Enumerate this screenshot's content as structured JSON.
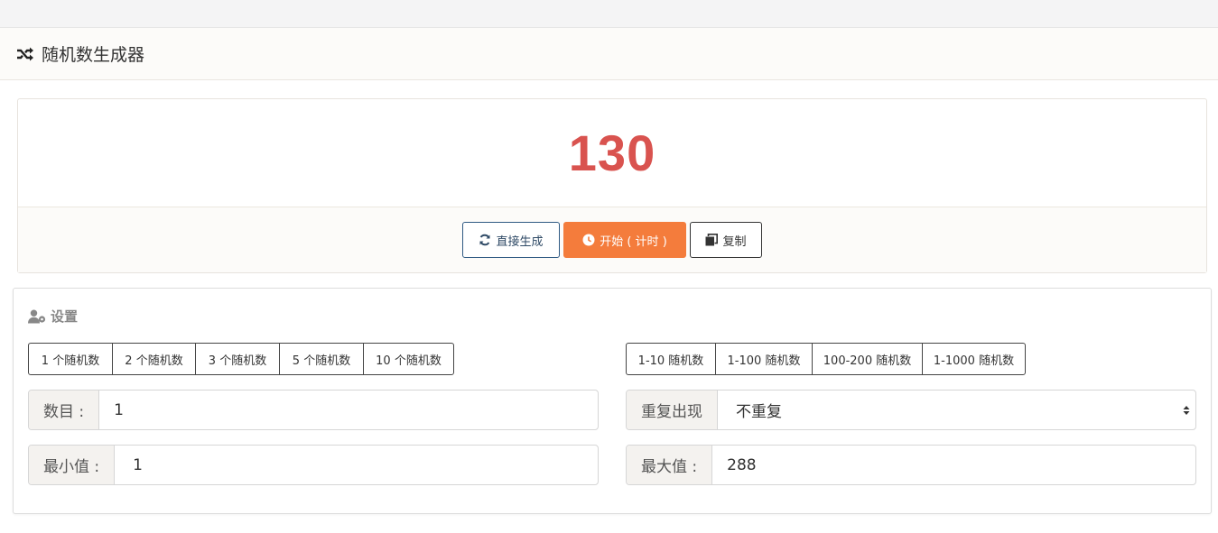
{
  "header": {
    "title": "随机数生成器",
    "icon": "shuffle-icon"
  },
  "result": {
    "value": "130",
    "color": "#d9534f"
  },
  "actions": {
    "regenerate_label": "直接生成",
    "start_label": "开始 ( 计时 )",
    "copy_label": "复制"
  },
  "settings": {
    "title": "设置",
    "count_presets": [
      "1 个随机数",
      "2 个随机数",
      "3 个随机数",
      "5 个随机数",
      "10 个随机数"
    ],
    "range_presets": [
      "1-10 随机数",
      "1-100 随机数",
      "100-200 随机数",
      "1-1000 随机数"
    ],
    "count": {
      "label": "数目 :",
      "value": "1"
    },
    "repeat": {
      "label": "重复出现",
      "value": "不重复"
    },
    "min": {
      "label": "最小值 :",
      "value": "1"
    },
    "max": {
      "label": "最大值 :",
      "value": "288"
    }
  },
  "colors": {
    "accent": "#f47c3c",
    "result": "#d9534f",
    "primary_border": "#2f5a83"
  }
}
